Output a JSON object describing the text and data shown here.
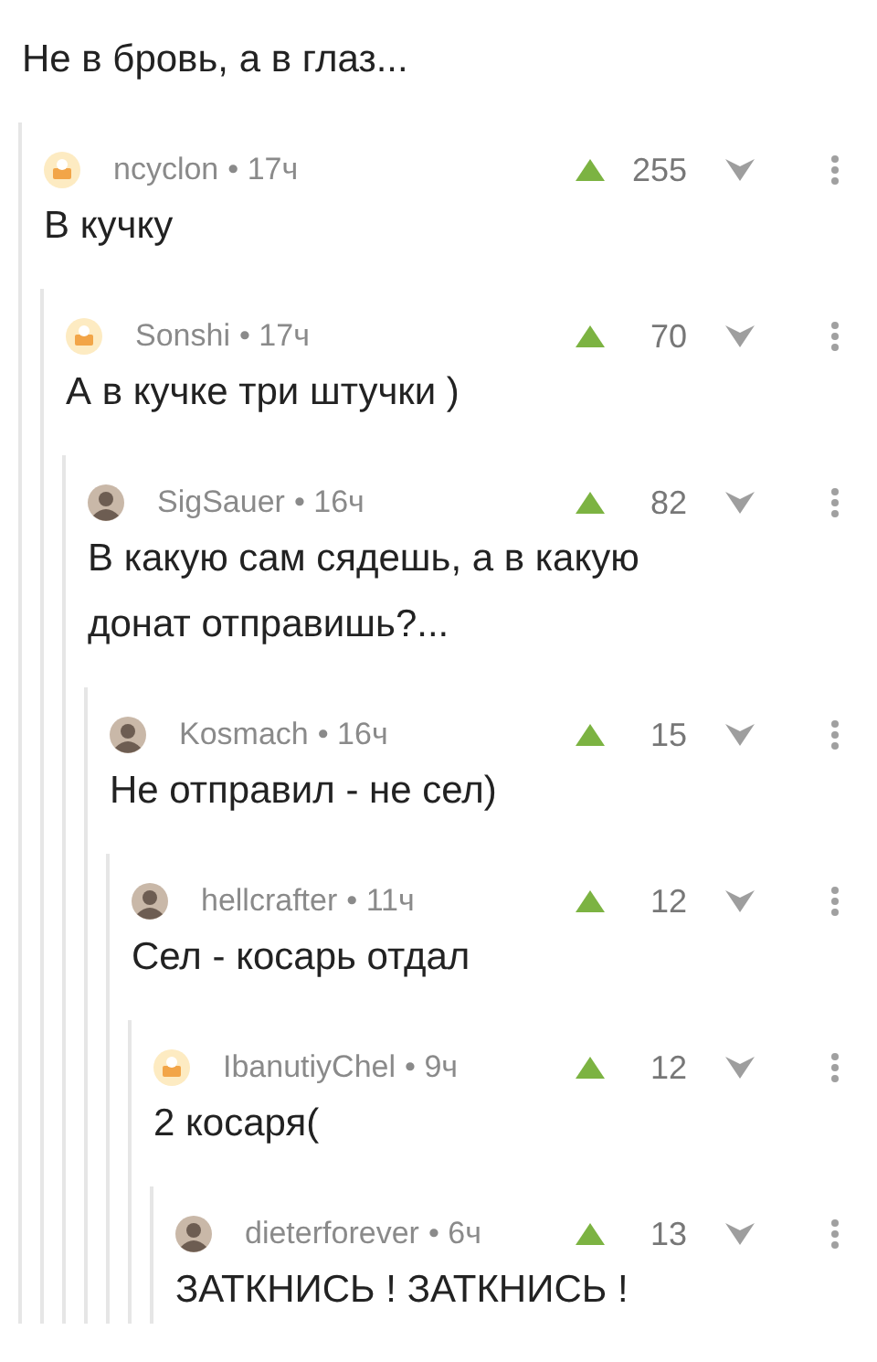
{
  "thread": {
    "body": "Не в бровь, а в глаз...",
    "children": [
      {
        "author": "ncyclon",
        "time": "• 17ч",
        "score": "255",
        "kind": "default",
        "body": "В кучку",
        "children": [
          {
            "author": "Sonshi",
            "time": "• 17ч",
            "score": "70",
            "kind": "default",
            "body": "А в кучке три штучки )",
            "children": [
              {
                "author": "SigSauer",
                "time": "• 16ч",
                "score": "82",
                "kind": "photo",
                "body": "В какую сам сядешь, а в какую донат отправишь?...",
                "children": [
                  {
                    "author": "Kosmach",
                    "time": "• 16ч",
                    "score": "15",
                    "kind": "photo",
                    "body": "Не отправил - не сел)",
                    "children": [
                      {
                        "author": "hellcrafter",
                        "time": "• 11ч",
                        "score": "12",
                        "kind": "photo",
                        "body": "Сел - косарь отдал",
                        "children": [
                          {
                            "author": "IbanutiyChel",
                            "time": "• 9ч",
                            "score": "12",
                            "kind": "default",
                            "body": "2 косаря(",
                            "children": [
                              {
                                "author": "dieterforever",
                                "time": "• 6ч",
                                "score": "13",
                                "kind": "photo",
                                "body": "ЗАТКНИСЬ ! ЗАТКНИСЬ !"
                              }
                            ]
                          }
                        ]
                      }
                    ]
                  }
                ]
              }
            ]
          }
        ]
      }
    ]
  }
}
